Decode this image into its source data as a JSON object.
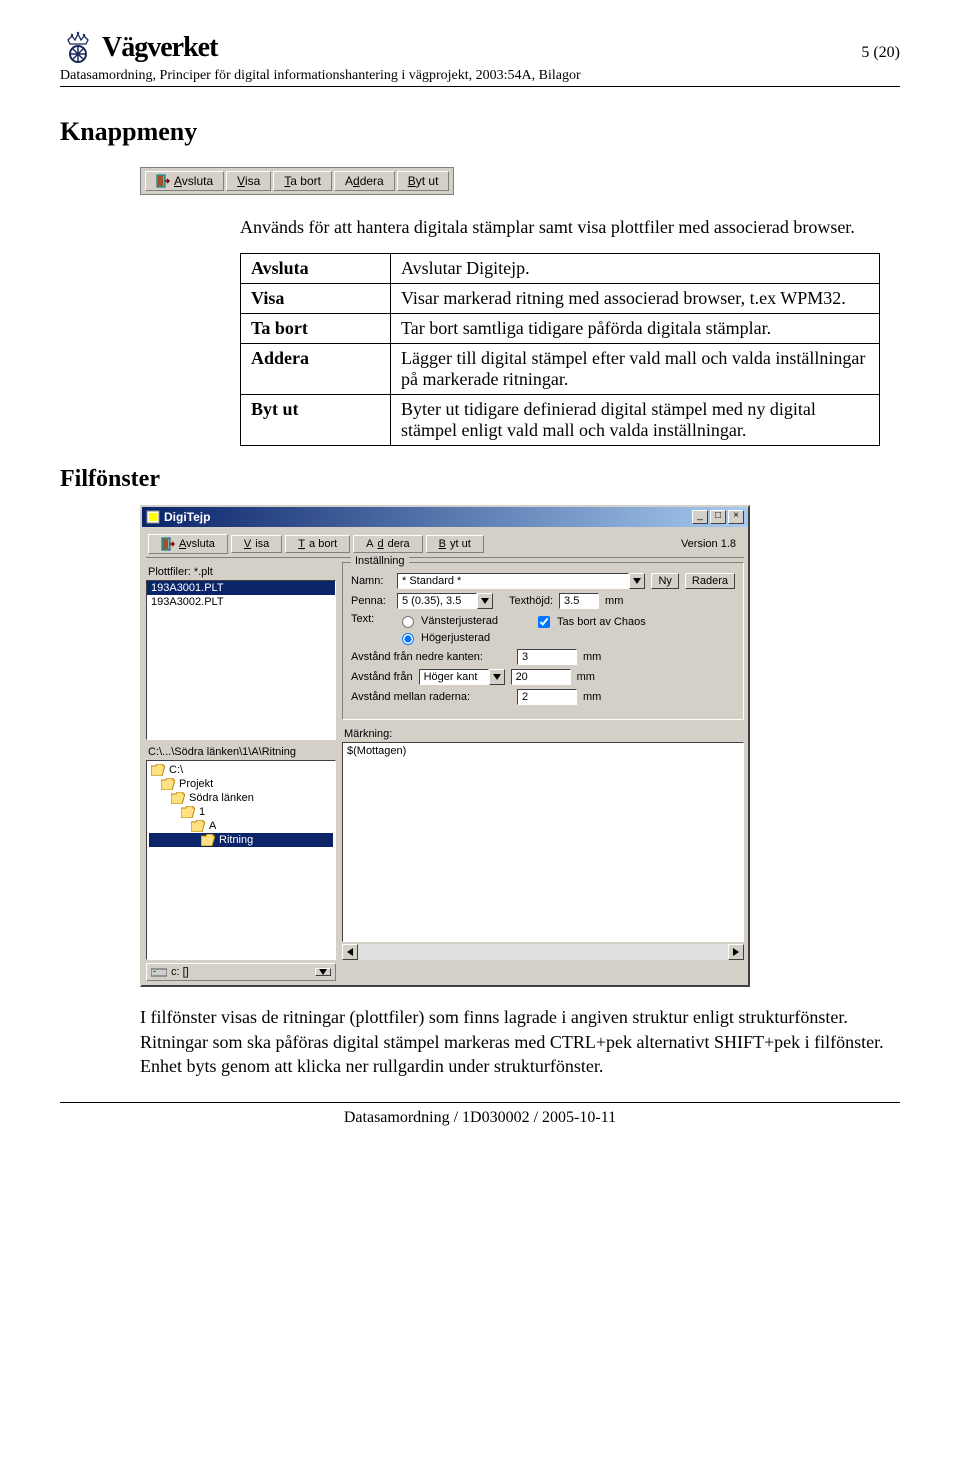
{
  "header": {
    "brand": "Vägverket",
    "page_number": "5 (20)",
    "subtitle": "Datasamordning, Principer för digital informationshantering i vägprojekt, 2003:54A, Bilagor"
  },
  "sections": {
    "knappmeny": "Knappmeny",
    "filfonster": "Filfönster"
  },
  "toolbar1": {
    "avsluta": "Avsluta",
    "visa": "Visa",
    "tabort": "Ta bort",
    "addera": "Addera",
    "bytut": "Byt ut"
  },
  "intro_text": "Används för att hantera digitala stämplar samt visa plottfiler med associerad browser.",
  "table": {
    "rows": [
      {
        "k": "Avsluta",
        "v": "Avslutar Digitejp."
      },
      {
        "k": "Visa",
        "v": "Visar markerad ritning med associerad browser, t.ex WPM32."
      },
      {
        "k": "Ta bort",
        "v": "Tar bort samtliga tidigare påförda digitala stämplar."
      },
      {
        "k": "Addera",
        "v": "Lägger till digital stämpel efter vald mall och valda inställningar på markerade ritningar."
      },
      {
        "k": "Byt ut",
        "v": "Byter ut tidigare definierad digital stämpel med ny digital stämpel enligt vald mall och valda inställningar."
      }
    ]
  },
  "app": {
    "title": "DigiTejp",
    "version": "Version 1.8",
    "plotfiler_label": "Plottfiler: *.plt",
    "plotfiler_items": [
      "193A3001.PLT",
      "193A3002.PLT"
    ],
    "path": "C:\\...\\Södra länken\\1\\A\\Ritning",
    "tree": [
      {
        "label": "C:\\",
        "indent": 0,
        "sel": false
      },
      {
        "label": "Projekt",
        "indent": 1,
        "sel": false
      },
      {
        "label": "Södra länken",
        "indent": 2,
        "sel": false
      },
      {
        "label": "1",
        "indent": 3,
        "sel": false
      },
      {
        "label": "A",
        "indent": 4,
        "sel": false
      },
      {
        "label": "Ritning",
        "indent": 5,
        "sel": true
      }
    ],
    "drive": "c: []",
    "settings": {
      "legend": "Inställning",
      "namn_label": "Namn:",
      "namn_value": "* Standard *",
      "ny": "Ny",
      "radera": "Radera",
      "penna_label": "Penna:",
      "penna_value": "5 (0.35), 3.5",
      "texthojd_label": "Texthöjd:",
      "texthojd_value": "3.5",
      "mm": "mm",
      "text_label": "Text:",
      "vanster": "Vänsterjusterad",
      "hoger": "Högerjusterad",
      "tas_bort": "Tas bort av Chaos",
      "avst_nedre_label": "Avstånd från nedre kanten:",
      "avst_nedre_value": "3",
      "avst_fran_label": "Avstånd från",
      "avst_fran_edge": "Höger kant",
      "avst_fran_value": "20",
      "avst_rader_label": "Avstånd mellan raderna:",
      "avst_rader_value": "2"
    },
    "markning_label": "Märkning:",
    "markning_value": "$(Mottagen)"
  },
  "body2": "I filfönster visas de ritningar (plottfiler) som finns lagrade i angiven struktur enligt strukturfönster. Ritningar som ska påföras digital stämpel markeras med CTRL+pek alternativt SHIFT+pek i filfönster. Enhet byts genom att klicka ner rullgardin under strukturfönster.",
  "footer": "Datasamordning / 1D030002 / 2005-10-11"
}
